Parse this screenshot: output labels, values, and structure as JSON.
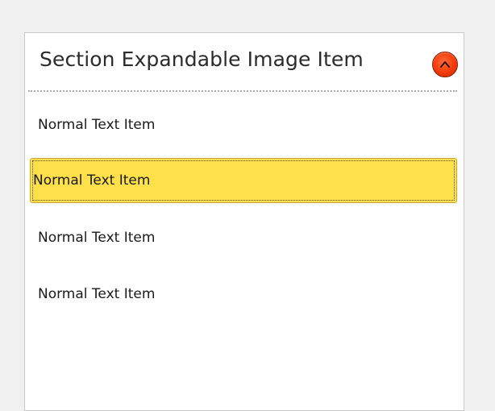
{
  "section": {
    "title": "Section Expandable Image Item",
    "toggle_icon": "chevron-up-icon",
    "toggle_color": "#f23b0c"
  },
  "items": [
    {
      "label": "Normal Text Item",
      "selected": false
    },
    {
      "label": "Normal Text Item",
      "selected": true
    },
    {
      "label": "Normal Text Item",
      "selected": false
    },
    {
      "label": "Normal Text Item",
      "selected": false
    }
  ],
  "colors": {
    "selected_background": "#fee04a",
    "panel_background": "#ffffff",
    "window_background": "#f0f0f0"
  }
}
